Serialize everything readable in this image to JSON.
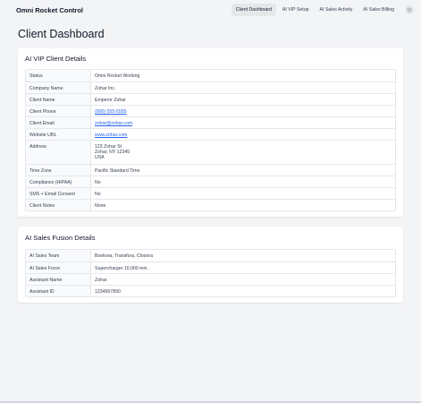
{
  "app": {
    "brand": "Omni Rocket Control"
  },
  "nav": {
    "items": [
      {
        "label": "Client Dashboard",
        "active": true
      },
      {
        "label": "AI VIP Setup",
        "active": false
      },
      {
        "label": "AI Sales Activity",
        "active": false
      },
      {
        "label": "AI Sales Billing",
        "active": false
      }
    ],
    "settings_icon": "gear-icon"
  },
  "page": {
    "title": "Client Dashboard"
  },
  "vip_card": {
    "title": "AI VIP Client Details",
    "rows": [
      {
        "label": "Status",
        "value": "Omni Rocket Working"
      },
      {
        "label": "Company Name",
        "value": "Zohar Inc."
      },
      {
        "label": "Client Name",
        "value": "Emperor Zohar"
      },
      {
        "label": "Client Phone",
        "value": "(800) 555-5555"
      },
      {
        "label": "Client Email",
        "value": "zohar@zohar.com"
      },
      {
        "label": "Website URL",
        "value": "www.zohar.com"
      },
      {
        "label": "Address",
        "line1": "123 Zohar St",
        "line2": "Zohar, NY 12345",
        "line3": "USA"
      },
      {
        "label": "Time Zone",
        "value": "Pacific Standard Time"
      },
      {
        "label": "Compliance (HIPAA)",
        "value": "No"
      },
      {
        "label": "SMS + Email Consent",
        "value": "No"
      },
      {
        "label": "Client Notes",
        "value": "None"
      }
    ]
  },
  "fusion_card": {
    "title": "AI Sales Fusion Details",
    "rows": [
      {
        "label": "AI Sales Team",
        "value": "Bookora, Transfora, Closora"
      },
      {
        "label": "AI Sales Force",
        "value": "Supercharger 10,000 min."
      },
      {
        "label": "Assistant Name",
        "value": "Zohar"
      },
      {
        "label": "Assistant ID",
        "value": "1234567890"
      }
    ]
  },
  "colors": {
    "link": "#2563eb",
    "background": "#f3f4f6",
    "card": "#ffffff"
  }
}
